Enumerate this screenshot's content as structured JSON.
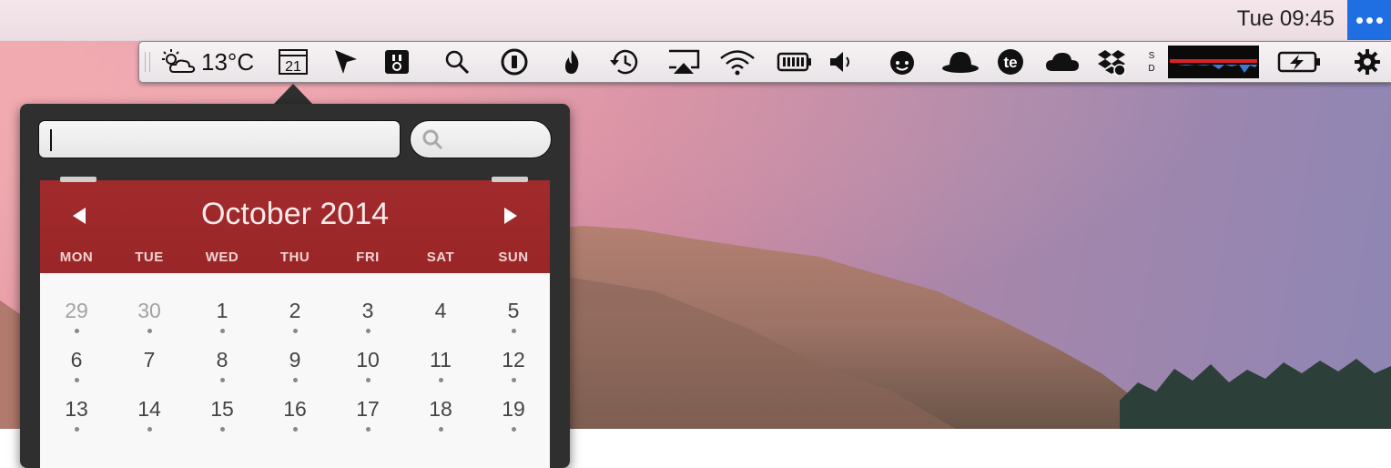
{
  "menubar": {
    "clock": "Tue 09:45",
    "overflow_icon": "ellipsis-icon",
    "accent": "#1f6fe2"
  },
  "tray": {
    "weather": {
      "icon": "partly-cloudy-icon",
      "temperature": "13°C"
    },
    "calendar_icon_day": "21",
    "icons": [
      "arrow-cursor-icon",
      "bartender-icon",
      "search-icon",
      "1password-icon",
      "flame-icon",
      "time-machine-icon",
      "airplay-icon",
      "wifi-icon",
      "battery-monitor-icon",
      "volume-icon",
      "smiley-icon",
      "bowler-hat-icon",
      "te-icon",
      "cloud-icon",
      "dropbox-icon",
      "network-monitor-icon",
      "graph-icon",
      "battery-charging-icon",
      "gear-icon"
    ],
    "graph_label": "S D"
  },
  "popover": {
    "event_input_value": "",
    "search_placeholder": ""
  },
  "calendar": {
    "month": "October 2014",
    "header_color": "#a12a2c",
    "weekdays": [
      "MON",
      "TUE",
      "WED",
      "THU",
      "FRI",
      "SAT",
      "SUN"
    ],
    "weeks": [
      [
        "29",
        "30",
        "1",
        "2",
        "3",
        "4",
        "5"
      ],
      [
        "6",
        "7",
        "8",
        "9",
        "10",
        "11",
        "12"
      ],
      [
        "13",
        "14",
        "15",
        "16",
        "17",
        "18",
        "19"
      ]
    ],
    "muted_days": [
      "29",
      "30"
    ]
  }
}
